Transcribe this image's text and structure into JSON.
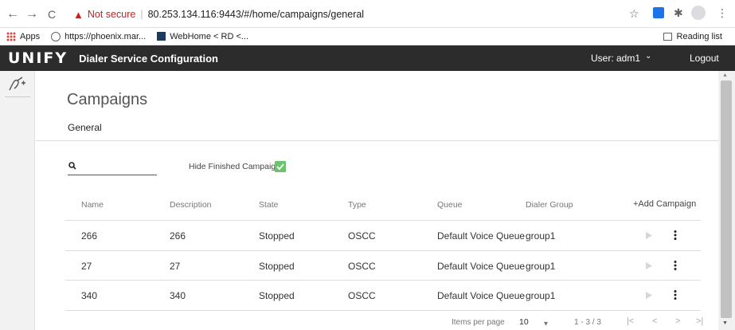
{
  "browser": {
    "back_glyph": "←",
    "forward_glyph": "→",
    "reload_glyph": "C",
    "not_secure": "Not secure",
    "separator": "|",
    "url": "80.253.134.116:9443/#/home/campaigns/general",
    "bookmarks": [
      {
        "label": "Apps"
      },
      {
        "label": "https://phoenix.mar..."
      },
      {
        "label": "WebHome < RD <..."
      }
    ],
    "reading_list": "Reading list"
  },
  "appbar": {
    "logo": "UNIFY",
    "title": "Dialer Service Configuration",
    "user": "User:  adm1",
    "user_caret": "⌄",
    "logout": "Logout"
  },
  "page": {
    "title": "Campaigns",
    "subtitle": "General",
    "search_placeholder": "",
    "hide_finished_label": "Hide Finished Campaigns",
    "hide_finished_checked": true
  },
  "table": {
    "columns": [
      "Name",
      "Description",
      "State",
      "Type",
      "Queue",
      "Dialer Group"
    ],
    "add_label": "+Add Campaign",
    "rows": [
      {
        "name": "266",
        "description": "266",
        "state": "Stopped",
        "type": "OSCC",
        "queue": "Default Voice Queue",
        "group": "group1"
      },
      {
        "name": "27",
        "description": "27",
        "state": "Stopped",
        "type": "OSCC",
        "queue": "Default Voice Queue",
        "group": "group1"
      },
      {
        "name": "340",
        "description": "340",
        "state": "Stopped",
        "type": "OSCC",
        "queue": "Default Voice Queue",
        "group": "group1"
      }
    ]
  },
  "pager": {
    "items_per_page_label": "Items per page",
    "page_size": "10",
    "caret": "▾",
    "range": "1 - 3 / 3",
    "first": "|<",
    "prev": "<",
    "next": ">",
    "last": ">|"
  }
}
